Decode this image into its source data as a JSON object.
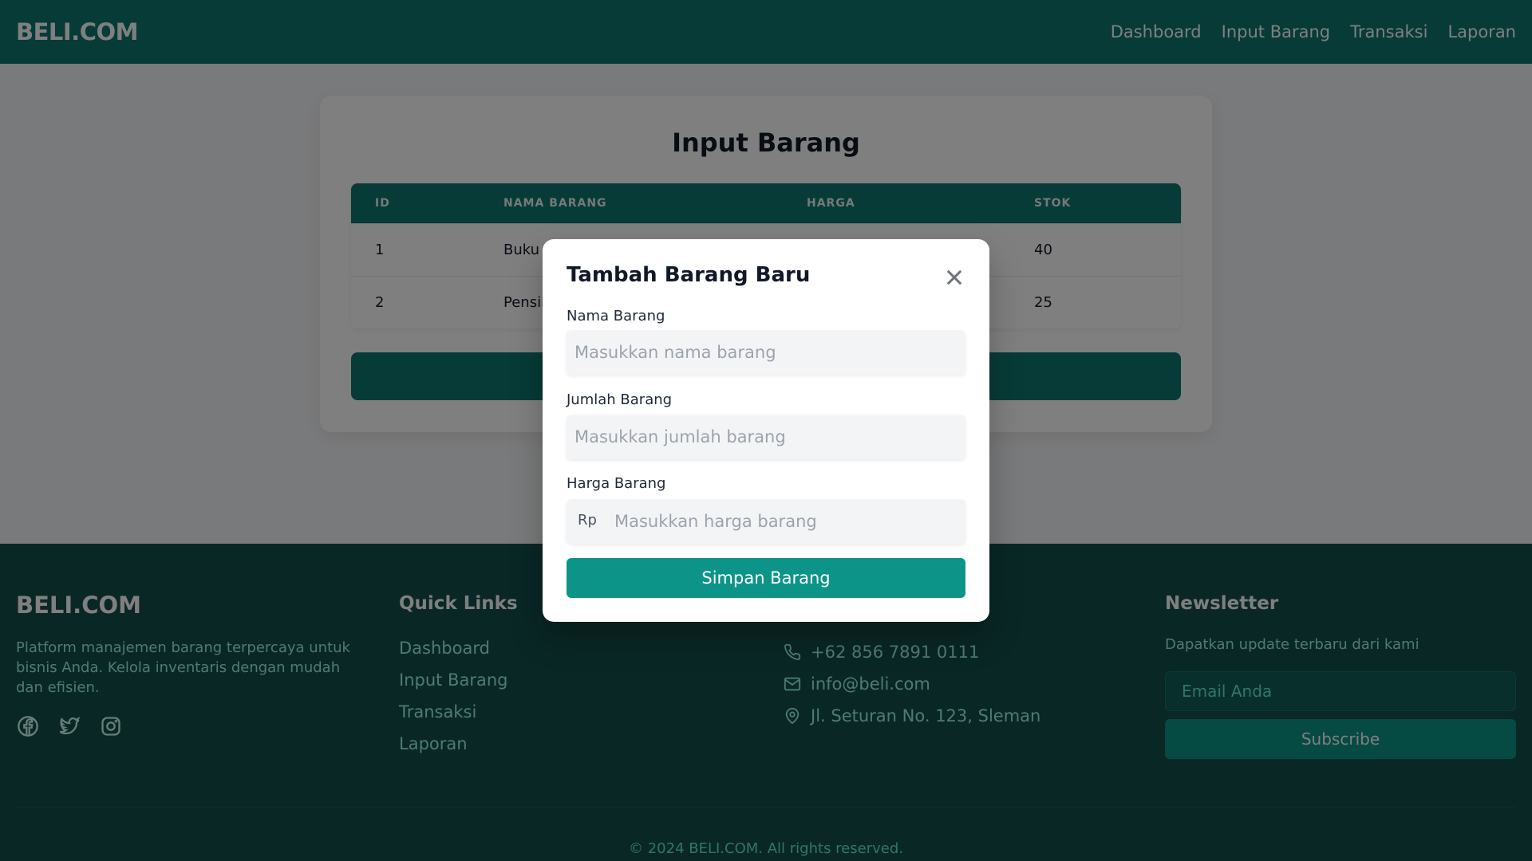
{
  "navbar": {
    "brand": "BELI.COM",
    "links": [
      "Dashboard",
      "Input Barang",
      "Transaksi",
      "Laporan"
    ]
  },
  "main": {
    "title": "Input Barang",
    "table": {
      "headers": [
        "ID",
        "NAMA BARANG",
        "HARGA",
        "STOK"
      ],
      "rows": [
        {
          "id": "1",
          "nama": "Buku",
          "harga": "",
          "stok": "40"
        },
        {
          "id": "2",
          "nama": "Pensil",
          "harga": "",
          "stok": "25"
        }
      ]
    }
  },
  "footer": {
    "brand": "BELI.COM",
    "description": "Platform manajemen barang terpercaya untuk bisnis Anda. Kelola inventaris dengan mudah dan efisien.",
    "quick_links_title": "Quick Links",
    "quick_links": [
      "Dashboard",
      "Input Barang",
      "Transaksi",
      "Laporan"
    ],
    "contact": {
      "phone": "+62 856 7891 0111",
      "email": "info@beli.com",
      "address": "Jl. Seturan No. 123, Sleman"
    },
    "newsletter": {
      "title": "Newsletter",
      "subtitle": "Dapatkan update terbaru dari kami",
      "placeholder": "Email Anda",
      "button": "Subscribe"
    },
    "copyright": "© 2024 BELI.COM. All rights reserved."
  },
  "modal": {
    "title": "Tambah Barang Baru",
    "nama_label": "Nama Barang",
    "nama_placeholder": "Masukkan nama barang",
    "jumlah_label": "Jumlah Barang",
    "jumlah_placeholder": "Masukkan jumlah barang",
    "harga_label": "Harga Barang",
    "harga_prefix": "Rp",
    "harga_placeholder": "Masukkan harga barang",
    "save_button": "Simpan Barang"
  },
  "colors": {
    "primary": "#0f766e",
    "accent": "#0d9488",
    "footer_bg": "#134e4a"
  }
}
